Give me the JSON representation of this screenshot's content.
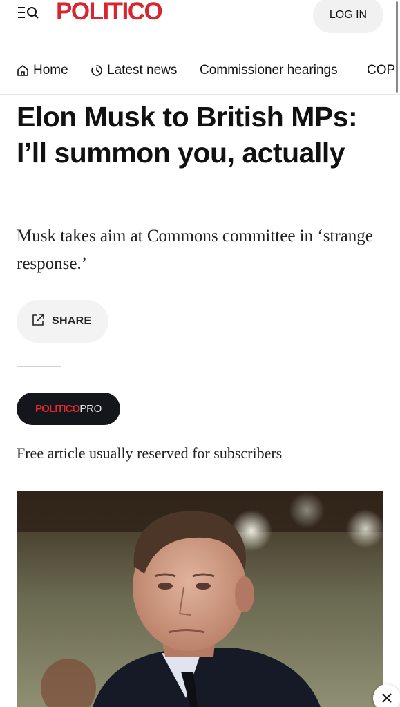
{
  "header": {
    "logo_text": "POLITICO",
    "login_label": "LOG IN",
    "brand_color": "#d8262f",
    "menu_icon": "menu-search-icon"
  },
  "nav": {
    "items": [
      {
        "label": "Home",
        "icon": "home-icon"
      },
      {
        "label": "Latest news",
        "icon": "clock-icon"
      },
      {
        "label": "Commissioner hearings"
      },
      {
        "label": "COP"
      }
    ]
  },
  "article": {
    "headline": "Elon Musk to British MPs: I’ll summon you, actually",
    "dek": "Musk takes aim at Commons committee in ‘strange response.’",
    "share_label": "SHARE",
    "share_icon": "share-icon",
    "pro_badge": {
      "part1": "POLITICO",
      "part2": "PRO"
    },
    "free_note": "Free article usually reserved for subscribers"
  },
  "overlay": {
    "close_icon": "close-icon"
  }
}
